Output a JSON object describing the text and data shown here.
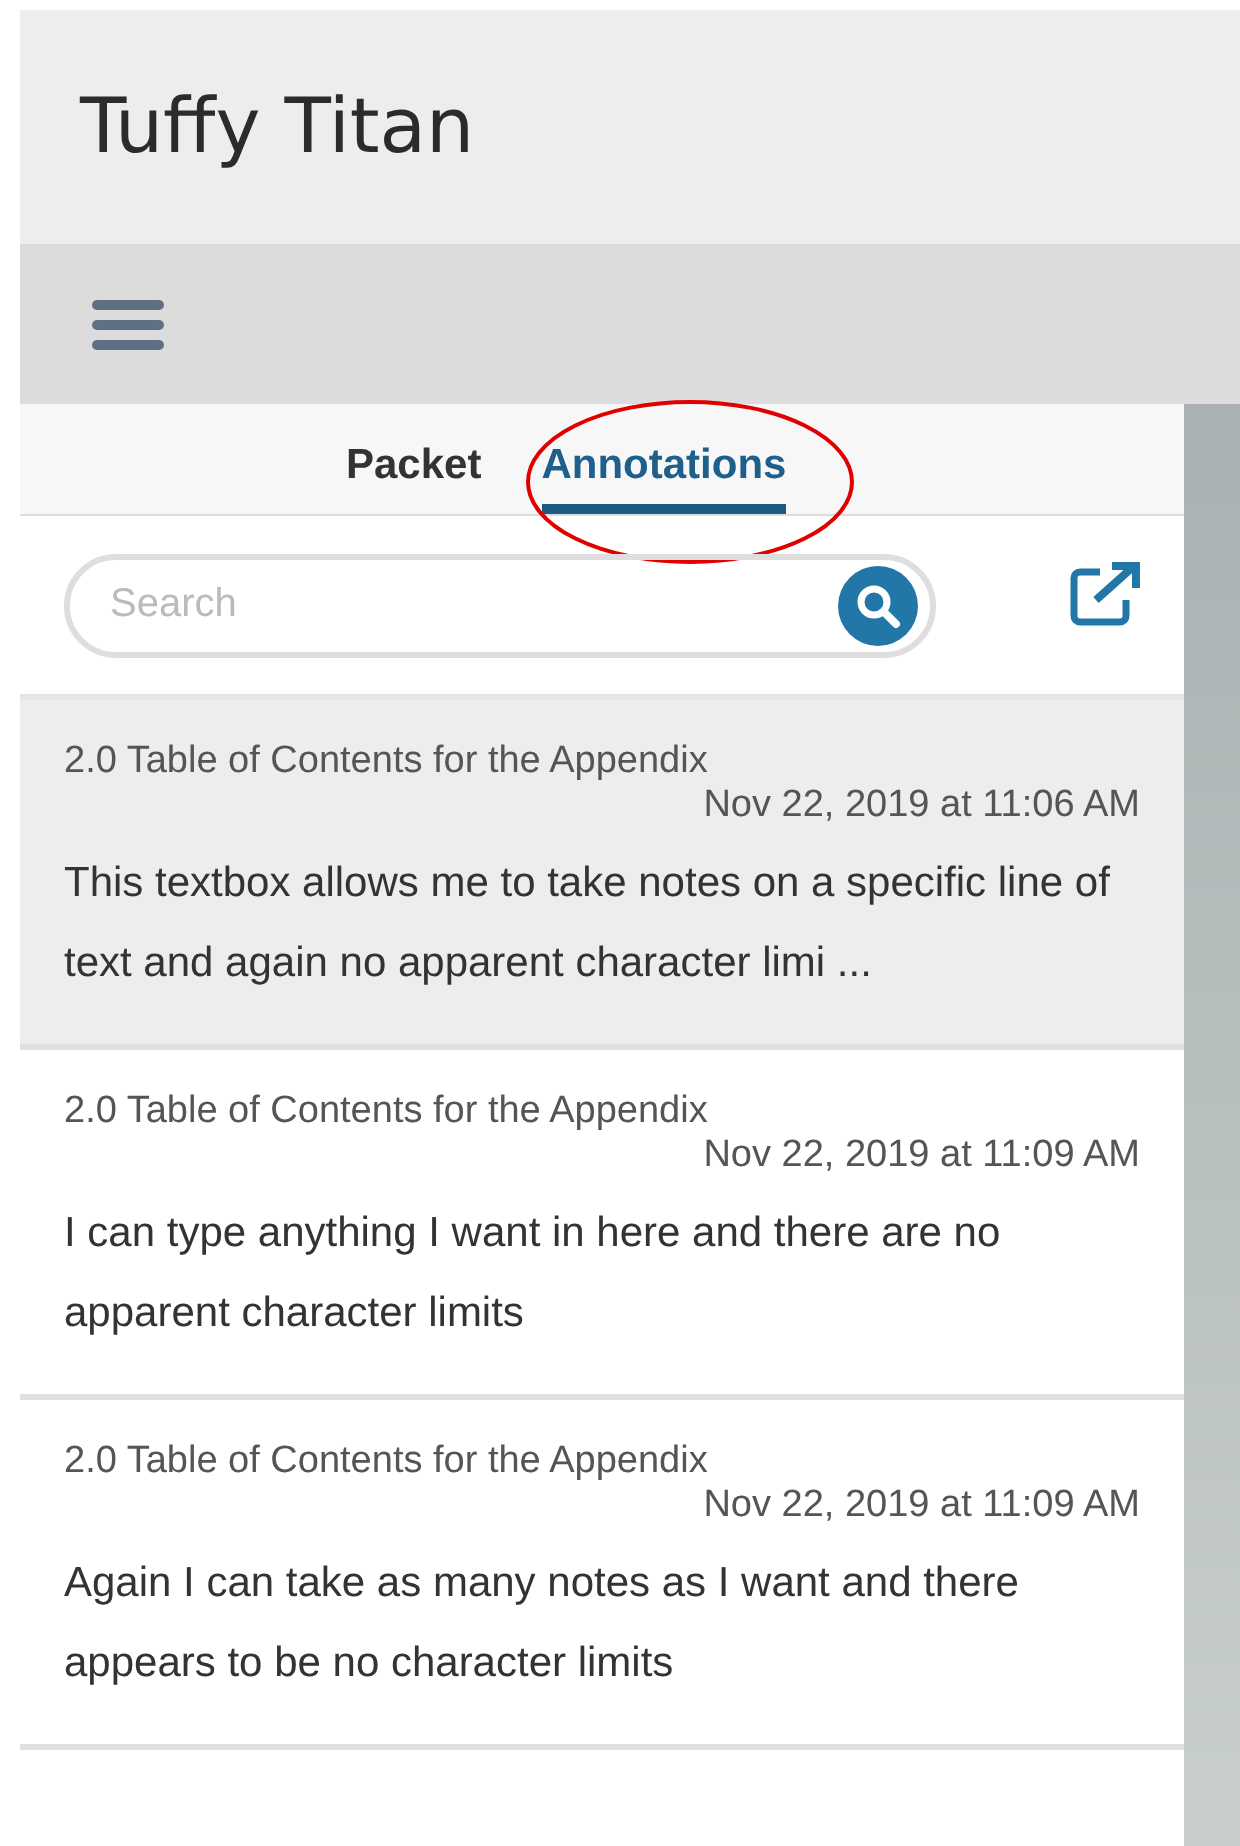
{
  "header": {
    "title": "Tuffy Titan"
  },
  "tabs": [
    {
      "label": "Packet",
      "selected": false
    },
    {
      "label": "Annotations",
      "selected": true
    }
  ],
  "search": {
    "placeholder": "Search"
  },
  "annotations": [
    {
      "section": "2.0 Table of Contents for the Appendix",
      "time": "Nov 22, 2019 at 11:06 AM",
      "text": "This textbox allows me to take notes on a specific line of text and again no apparent character limi ...",
      "selected": true
    },
    {
      "section": "2.0 Table of Contents for the Appendix",
      "time": "Nov 22, 2019 at 11:09 AM",
      "text": "I can type anything I want in here and there are no apparent character limits",
      "selected": false
    },
    {
      "section": "2.0 Table of Contents for the Appendix",
      "time": "Nov 22, 2019 at 11:09 AM",
      "text": "Again I can take as many notes as I want and there appears to be no character limits",
      "selected": false
    }
  ]
}
